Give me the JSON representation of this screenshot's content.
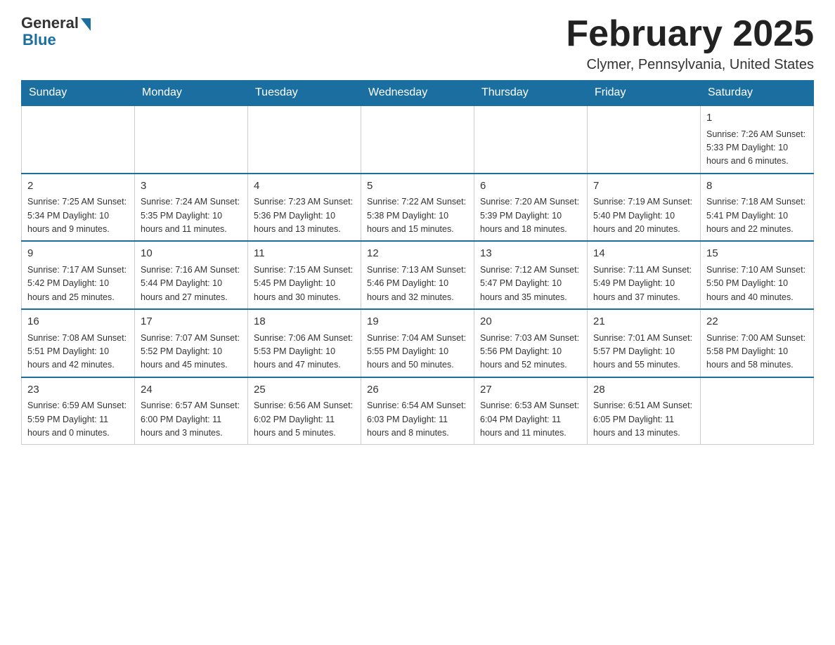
{
  "header": {
    "logo_general": "General",
    "logo_blue": "Blue",
    "month_title": "February 2025",
    "location": "Clymer, Pennsylvania, United States"
  },
  "days_of_week": [
    "Sunday",
    "Monday",
    "Tuesday",
    "Wednesday",
    "Thursday",
    "Friday",
    "Saturday"
  ],
  "weeks": [
    [
      {
        "day": "",
        "info": ""
      },
      {
        "day": "",
        "info": ""
      },
      {
        "day": "",
        "info": ""
      },
      {
        "day": "",
        "info": ""
      },
      {
        "day": "",
        "info": ""
      },
      {
        "day": "",
        "info": ""
      },
      {
        "day": "1",
        "info": "Sunrise: 7:26 AM\nSunset: 5:33 PM\nDaylight: 10 hours and 6 minutes."
      }
    ],
    [
      {
        "day": "2",
        "info": "Sunrise: 7:25 AM\nSunset: 5:34 PM\nDaylight: 10 hours and 9 minutes."
      },
      {
        "day": "3",
        "info": "Sunrise: 7:24 AM\nSunset: 5:35 PM\nDaylight: 10 hours and 11 minutes."
      },
      {
        "day": "4",
        "info": "Sunrise: 7:23 AM\nSunset: 5:36 PM\nDaylight: 10 hours and 13 minutes."
      },
      {
        "day": "5",
        "info": "Sunrise: 7:22 AM\nSunset: 5:38 PM\nDaylight: 10 hours and 15 minutes."
      },
      {
        "day": "6",
        "info": "Sunrise: 7:20 AM\nSunset: 5:39 PM\nDaylight: 10 hours and 18 minutes."
      },
      {
        "day": "7",
        "info": "Sunrise: 7:19 AM\nSunset: 5:40 PM\nDaylight: 10 hours and 20 minutes."
      },
      {
        "day": "8",
        "info": "Sunrise: 7:18 AM\nSunset: 5:41 PM\nDaylight: 10 hours and 22 minutes."
      }
    ],
    [
      {
        "day": "9",
        "info": "Sunrise: 7:17 AM\nSunset: 5:42 PM\nDaylight: 10 hours and 25 minutes."
      },
      {
        "day": "10",
        "info": "Sunrise: 7:16 AM\nSunset: 5:44 PM\nDaylight: 10 hours and 27 minutes."
      },
      {
        "day": "11",
        "info": "Sunrise: 7:15 AM\nSunset: 5:45 PM\nDaylight: 10 hours and 30 minutes."
      },
      {
        "day": "12",
        "info": "Sunrise: 7:13 AM\nSunset: 5:46 PM\nDaylight: 10 hours and 32 minutes."
      },
      {
        "day": "13",
        "info": "Sunrise: 7:12 AM\nSunset: 5:47 PM\nDaylight: 10 hours and 35 minutes."
      },
      {
        "day": "14",
        "info": "Sunrise: 7:11 AM\nSunset: 5:49 PM\nDaylight: 10 hours and 37 minutes."
      },
      {
        "day": "15",
        "info": "Sunrise: 7:10 AM\nSunset: 5:50 PM\nDaylight: 10 hours and 40 minutes."
      }
    ],
    [
      {
        "day": "16",
        "info": "Sunrise: 7:08 AM\nSunset: 5:51 PM\nDaylight: 10 hours and 42 minutes."
      },
      {
        "day": "17",
        "info": "Sunrise: 7:07 AM\nSunset: 5:52 PM\nDaylight: 10 hours and 45 minutes."
      },
      {
        "day": "18",
        "info": "Sunrise: 7:06 AM\nSunset: 5:53 PM\nDaylight: 10 hours and 47 minutes."
      },
      {
        "day": "19",
        "info": "Sunrise: 7:04 AM\nSunset: 5:55 PM\nDaylight: 10 hours and 50 minutes."
      },
      {
        "day": "20",
        "info": "Sunrise: 7:03 AM\nSunset: 5:56 PM\nDaylight: 10 hours and 52 minutes."
      },
      {
        "day": "21",
        "info": "Sunrise: 7:01 AM\nSunset: 5:57 PM\nDaylight: 10 hours and 55 minutes."
      },
      {
        "day": "22",
        "info": "Sunrise: 7:00 AM\nSunset: 5:58 PM\nDaylight: 10 hours and 58 minutes."
      }
    ],
    [
      {
        "day": "23",
        "info": "Sunrise: 6:59 AM\nSunset: 5:59 PM\nDaylight: 11 hours and 0 minutes."
      },
      {
        "day": "24",
        "info": "Sunrise: 6:57 AM\nSunset: 6:00 PM\nDaylight: 11 hours and 3 minutes."
      },
      {
        "day": "25",
        "info": "Sunrise: 6:56 AM\nSunset: 6:02 PM\nDaylight: 11 hours and 5 minutes."
      },
      {
        "day": "26",
        "info": "Sunrise: 6:54 AM\nSunset: 6:03 PM\nDaylight: 11 hours and 8 minutes."
      },
      {
        "day": "27",
        "info": "Sunrise: 6:53 AM\nSunset: 6:04 PM\nDaylight: 11 hours and 11 minutes."
      },
      {
        "day": "28",
        "info": "Sunrise: 6:51 AM\nSunset: 6:05 PM\nDaylight: 11 hours and 13 minutes."
      },
      {
        "day": "",
        "info": ""
      }
    ]
  ]
}
